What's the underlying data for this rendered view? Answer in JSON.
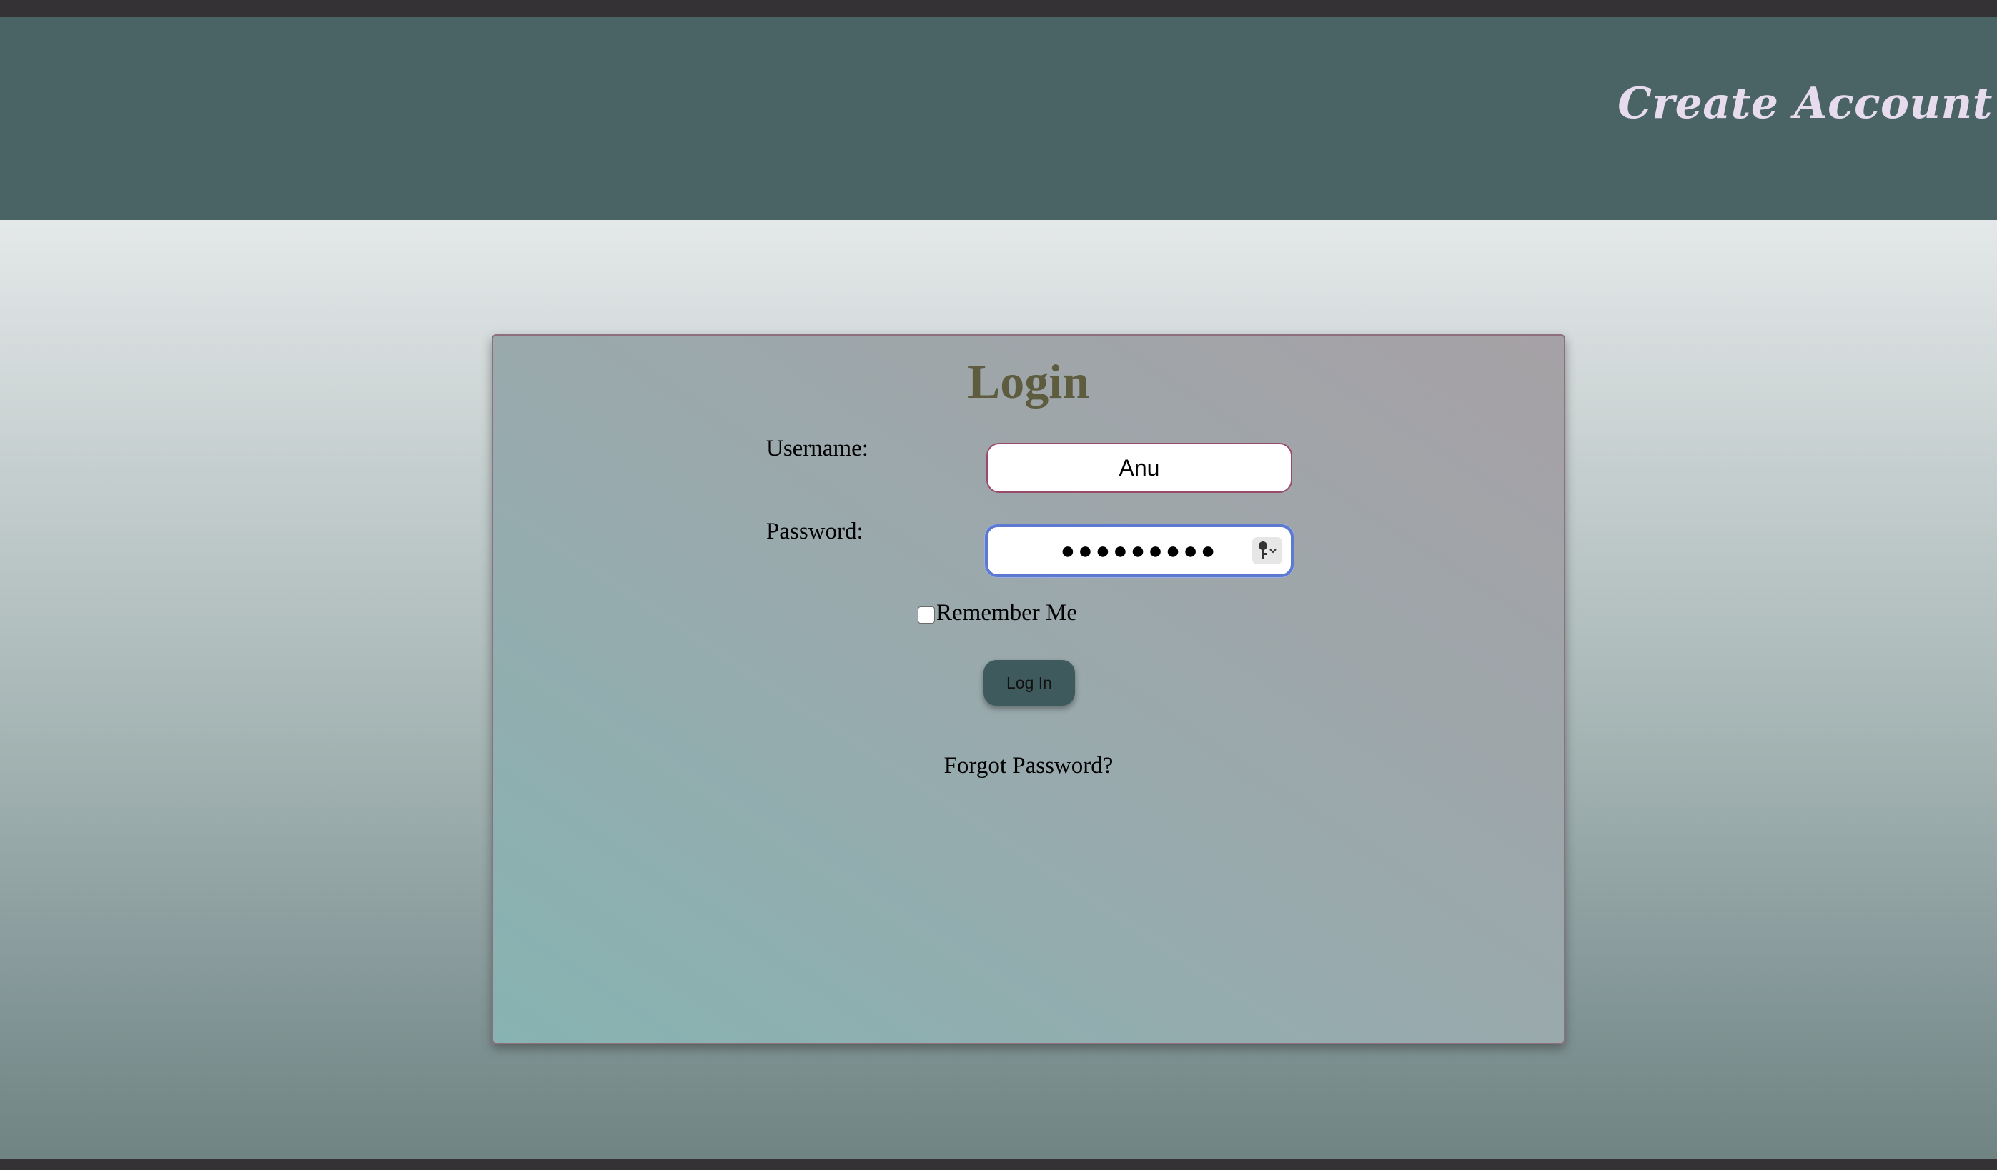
{
  "header": {
    "create_account_label": "Create Account"
  },
  "login_form": {
    "title": "Login",
    "username_label": "Username:",
    "username_value": "Anu",
    "password_label": "Password:",
    "password_masked": "●●●●●●●●●",
    "remember_me_label": "Remember Me",
    "remember_me_checked": false,
    "login_button_label": "Log In",
    "forgot_password_label": "Forgot Password?"
  },
  "icons": {
    "password_manager": "key-icon"
  },
  "colors": {
    "header_bg": "#4a6466",
    "header_link": "#e6dcee",
    "title": "#5e5c3f",
    "button_bg": "#3f5a5c",
    "focus_ring": "#5e7ad0"
  }
}
